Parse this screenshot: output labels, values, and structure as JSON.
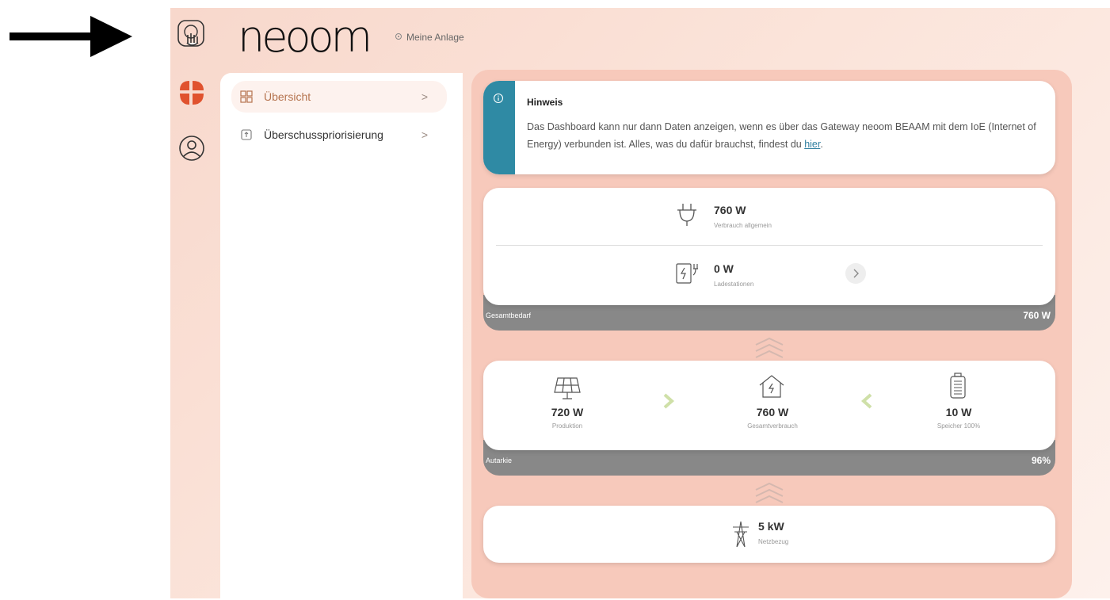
{
  "app": {
    "logo": "neoom",
    "location": "Meine Anlage"
  },
  "nav": [
    {
      "label": "Übersicht",
      "chevron": ">"
    },
    {
      "label": "Überschusspriorisierung",
      "chevron": ">"
    }
  ],
  "notice": {
    "title": "Hinweis",
    "text": "Das Dashboard kann nur dann Daten anzeigen, wenn es über das Gateway neoom BEAAM mit dem IoE (Internet of Energy) verbunden ist. Alles, was du dafür brauchst, findest du ",
    "link": "hier",
    "end": "."
  },
  "demand": {
    "consumption": {
      "value": "760 W",
      "label": "Verbrauch allgemein"
    },
    "charging": {
      "value": "0 W",
      "label": "Ladestationen"
    },
    "total_label": "Gesamtbedarf",
    "total_value": "760 W"
  },
  "energy": {
    "production": {
      "value": "720 W",
      "label": "Produktion"
    },
    "total_consumption": {
      "value": "760 W",
      "label": "Gesamtverbrauch"
    },
    "storage": {
      "value": "10 W",
      "label": "Speicher 100%"
    },
    "autarky_label": "Autarkie",
    "autarky_value": "96%"
  },
  "grid": {
    "value": "5 kW",
    "label": "Netzbezug"
  },
  "colors": {
    "accent": "#2f8aa4",
    "nav_text": "#b5734e",
    "brand_orange": "#e0522e",
    "bar_grey": "#888888"
  }
}
